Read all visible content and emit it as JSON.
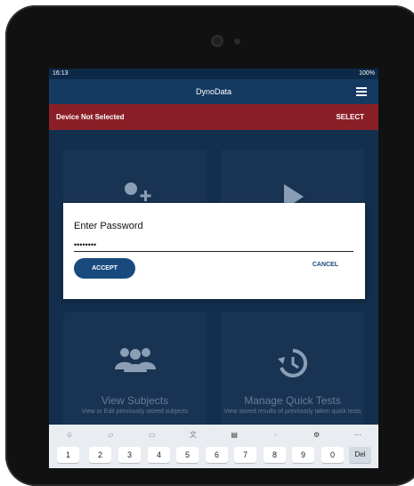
{
  "status_bar": {
    "time": "16:13",
    "battery": "100%"
  },
  "app_bar": {
    "title": "DynoData",
    "menu_icon": "hamburger-menu-icon"
  },
  "device_banner": {
    "label": "Device Not Selected",
    "action": "SELECT",
    "color": "#8b1f27"
  },
  "tiles": [
    {
      "title": "",
      "subtitle": "",
      "icon": "add-user-icon"
    },
    {
      "title": "",
      "subtitle": "",
      "icon": "play-icon"
    },
    {
      "title": "View Subjects",
      "subtitle": "View or Edit previously stored subjects",
      "icon": "group-icon"
    },
    {
      "title": "Manage Quick Tests",
      "subtitle": "View stored results of previously taken quick tests",
      "icon": "history-icon"
    }
  ],
  "dialog": {
    "title": "Enter Password",
    "password_value": "••••••••",
    "accept_label": "ACCEPT",
    "cancel_label": "CANCEL"
  },
  "keyboard": {
    "keys": [
      "1",
      "2",
      "3",
      "4",
      "5",
      "6",
      "7",
      "8",
      "9",
      "0",
      "Del"
    ]
  },
  "colors": {
    "accent": "#184a7e",
    "header": "#153a62",
    "banner": "#8b1f27"
  }
}
